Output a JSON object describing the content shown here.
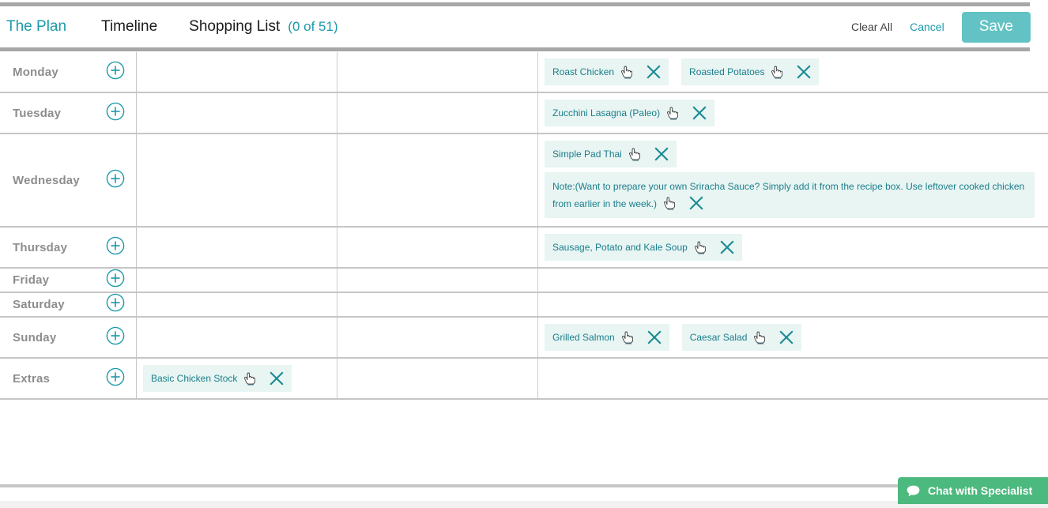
{
  "header": {
    "nav": [
      {
        "label": "The Plan",
        "accent": true
      },
      {
        "label": "Timeline",
        "accent": false
      },
      {
        "label": "Shopping List",
        "accent": false
      }
    ],
    "count_label": "(0 of 51)",
    "clear_all_label": "Clear All",
    "cancel_label": "Cancel",
    "save_label": "Save"
  },
  "icons": {
    "add": "plus-circle-icon",
    "remove": "close-x-icon",
    "drag": "hand-pointer-icon",
    "chat": "chat-bubble-icon"
  },
  "colors": {
    "accent_teal": "#1b9aaa",
    "save_button": "#63c3c4",
    "chip_background": "#e8f5f2",
    "chip_text": "#1b7d8c",
    "chat_green": "#4cb97e",
    "day_label": "#8d8d8d",
    "rule_gray": "#c6c6c6"
  },
  "plan": {
    "rows": [
      {
        "day": "Monday",
        "breakfast": [],
        "lunch": [],
        "dinner": [
          {
            "text": "Roast Chicken",
            "note": false
          },
          {
            "text": "Roasted Potatoes",
            "note": false
          }
        ]
      },
      {
        "day": "Tuesday",
        "breakfast": [],
        "lunch": [],
        "dinner": [
          {
            "text": "Zucchini Lasagna (Paleo)",
            "note": false
          }
        ]
      },
      {
        "day": "Wednesday",
        "breakfast": [],
        "lunch": [],
        "dinner": [
          {
            "text": "Simple Pad Thai",
            "note": false
          },
          {
            "text": "Note:(Want to prepare your own Sriracha Sauce? Simply add it from the recipe box. Use leftover cooked chicken from earlier in the week.)",
            "note": true
          }
        ]
      },
      {
        "day": "Thursday",
        "breakfast": [],
        "lunch": [],
        "dinner": [
          {
            "text": "Sausage, Potato and Kale Soup",
            "note": false
          }
        ]
      },
      {
        "day": "Friday",
        "breakfast": [],
        "lunch": [],
        "dinner": []
      },
      {
        "day": "Saturday",
        "breakfast": [],
        "lunch": [],
        "dinner": []
      },
      {
        "day": "Sunday",
        "breakfast": [],
        "lunch": [],
        "dinner": [
          {
            "text": "Grilled Salmon",
            "note": false
          },
          {
            "text": "Caesar Salad",
            "note": false
          }
        ]
      },
      {
        "day": "Extras",
        "breakfast": [
          {
            "text": "Basic Chicken Stock",
            "note": false
          }
        ],
        "lunch": [],
        "dinner": []
      }
    ]
  },
  "chat": {
    "label": "Chat with Specialist"
  }
}
